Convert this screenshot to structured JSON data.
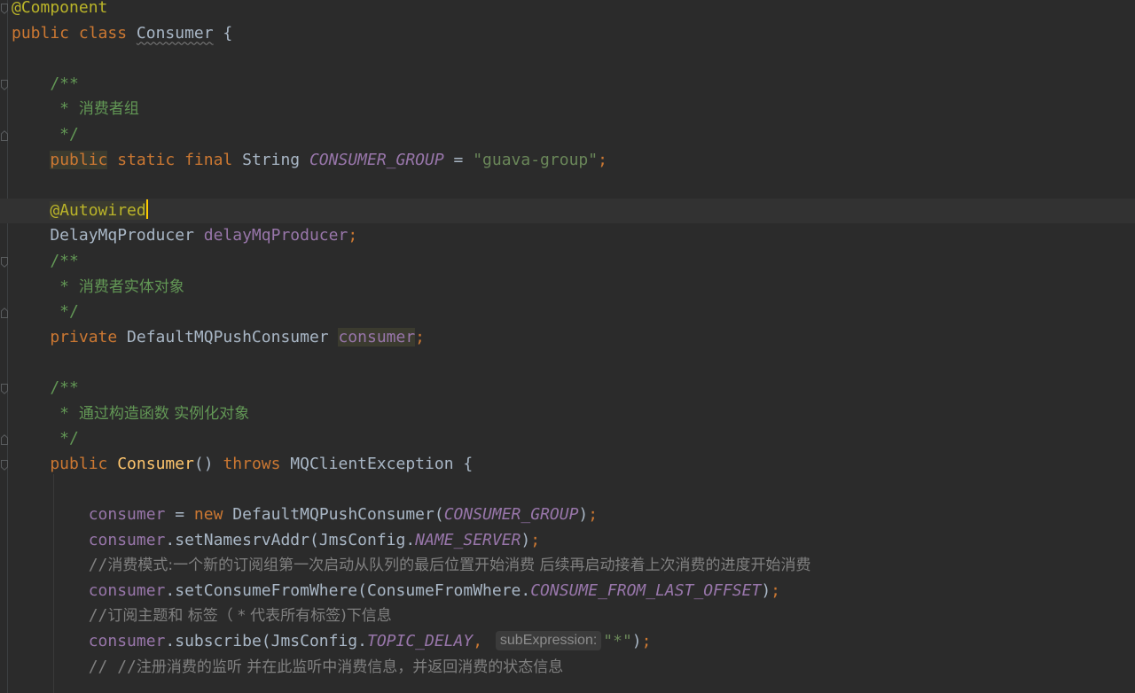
{
  "editor": {
    "lines": [
      {
        "tokens": [
          {
            "t": "@Component",
            "c": "ann"
          }
        ]
      },
      {
        "tokens": [
          {
            "t": "public class ",
            "c": "kw"
          },
          {
            "t": "Consumer",
            "c": "cls",
            "squiggle": true
          },
          {
            "t": " {",
            "c": "plain"
          }
        ]
      },
      {
        "tokens": []
      },
      {
        "tokens": [
          {
            "t": "    /**",
            "c": "doc"
          }
        ]
      },
      {
        "tokens": [
          {
            "t": "     * ",
            "c": "doc"
          },
          {
            "t": "消费者组",
            "c": "doc",
            "cjk": true
          }
        ]
      },
      {
        "tokens": [
          {
            "t": "     */",
            "c": "doc"
          }
        ]
      },
      {
        "tokens": [
          {
            "t": "    ",
            "c": "plain"
          },
          {
            "t": "public",
            "c": "kw",
            "hl": true
          },
          {
            "t": " static final ",
            "c": "kw"
          },
          {
            "t": "String ",
            "c": "cls"
          },
          {
            "t": "CONSUMER_GROUP",
            "c": "const"
          },
          {
            "t": " = ",
            "c": "plain"
          },
          {
            "t": "\"guava-group\"",
            "c": "str"
          },
          {
            "t": ";",
            "c": "punct"
          }
        ]
      },
      {
        "tokens": []
      },
      {
        "tokens": [
          {
            "t": "    ",
            "c": "plain"
          },
          {
            "t": "@Autowired",
            "c": "ann",
            "hl": true
          },
          {
            "cursor": true
          }
        ],
        "caret": true
      },
      {
        "tokens": [
          {
            "t": "    DelayMqProducer ",
            "c": "cls"
          },
          {
            "t": "delayMqProducer",
            "c": "field"
          },
          {
            "t": ";",
            "c": "punct"
          }
        ]
      },
      {
        "tokens": [
          {
            "t": "    /**",
            "c": "doc"
          }
        ]
      },
      {
        "tokens": [
          {
            "t": "     * ",
            "c": "doc"
          },
          {
            "t": "消费者实体对象",
            "c": "doc",
            "cjk": true
          }
        ]
      },
      {
        "tokens": [
          {
            "t": "     */",
            "c": "doc"
          }
        ]
      },
      {
        "tokens": [
          {
            "t": "    private ",
            "c": "kw"
          },
          {
            "t": "DefaultMQPushConsumer ",
            "c": "cls"
          },
          {
            "t": "consumer",
            "c": "field",
            "hl": true
          },
          {
            "t": ";",
            "c": "punct"
          }
        ]
      },
      {
        "tokens": []
      },
      {
        "tokens": [
          {
            "t": "    /**",
            "c": "doc"
          }
        ]
      },
      {
        "tokens": [
          {
            "t": "     * ",
            "c": "doc"
          },
          {
            "t": "通过构造函数 实例化对象",
            "c": "doc",
            "cjk": true
          }
        ]
      },
      {
        "tokens": [
          {
            "t": "     */",
            "c": "doc"
          }
        ]
      },
      {
        "tokens": [
          {
            "t": "    public ",
            "c": "kw"
          },
          {
            "t": "Consumer",
            "c": "method"
          },
          {
            "t": "() ",
            "c": "plain"
          },
          {
            "t": "throws ",
            "c": "kw"
          },
          {
            "t": "MQClientException {",
            "c": "plain"
          }
        ]
      },
      {
        "tokens": []
      },
      {
        "tokens": [
          {
            "t": "        ",
            "c": "plain"
          },
          {
            "t": "consumer",
            "c": "field"
          },
          {
            "t": " = ",
            "c": "plain"
          },
          {
            "t": "new ",
            "c": "kw"
          },
          {
            "t": "DefaultMQPushConsumer(",
            "c": "plain"
          },
          {
            "t": "CONSUMER_GROUP",
            "c": "const"
          },
          {
            "t": ")",
            "c": "plain"
          },
          {
            "t": ";",
            "c": "punct"
          }
        ]
      },
      {
        "tokens": [
          {
            "t": "        ",
            "c": "plain"
          },
          {
            "t": "consumer",
            "c": "field"
          },
          {
            "t": ".setNamesrvAddr(JmsConfig.",
            "c": "plain"
          },
          {
            "t": "NAME_SERVER",
            "c": "const"
          },
          {
            "t": ")",
            "c": "plain"
          },
          {
            "t": ";",
            "c": "punct"
          }
        ]
      },
      {
        "tokens": [
          {
            "t": "        //",
            "c": "comment"
          },
          {
            "t": "消费模式:一个新的订阅组第一次启动从队列的最后位置开始消费 后续再启动接着上次消费的进度开始消费",
            "c": "comment",
            "cjk": true
          }
        ]
      },
      {
        "tokens": [
          {
            "t": "        ",
            "c": "plain"
          },
          {
            "t": "consumer",
            "c": "field"
          },
          {
            "t": ".setConsumeFromWhere(ConsumeFromWhere.",
            "c": "plain"
          },
          {
            "t": "CONSUME_FROM_LAST_OFFSET",
            "c": "const"
          },
          {
            "t": ")",
            "c": "plain"
          },
          {
            "t": ";",
            "c": "punct"
          }
        ]
      },
      {
        "tokens": [
          {
            "t": "        //",
            "c": "comment"
          },
          {
            "t": "订阅主题和 标签（ * 代表所有标签)下信息",
            "c": "comment",
            "cjk": true
          }
        ]
      },
      {
        "tokens": [
          {
            "t": "        ",
            "c": "plain"
          },
          {
            "t": "consumer",
            "c": "field"
          },
          {
            "t": ".subscribe(JmsConfig.",
            "c": "plain"
          },
          {
            "t": "TOPIC_DELAY",
            "c": "const"
          },
          {
            "t": ", ",
            "c": "punct"
          },
          {
            "hint": "subExpression:"
          },
          {
            "t": "\"*\"",
            "c": "str"
          },
          {
            "t": ")",
            "c": "plain"
          },
          {
            "t": ";",
            "c": "punct"
          }
        ]
      },
      {
        "tokens": [
          {
            "t": "        // //",
            "c": "comment"
          },
          {
            "t": "注册消费的监听 并在此监听中消费信息，并返回消费的状态信息",
            "c": "comment",
            "cjk": true
          }
        ]
      }
    ]
  }
}
